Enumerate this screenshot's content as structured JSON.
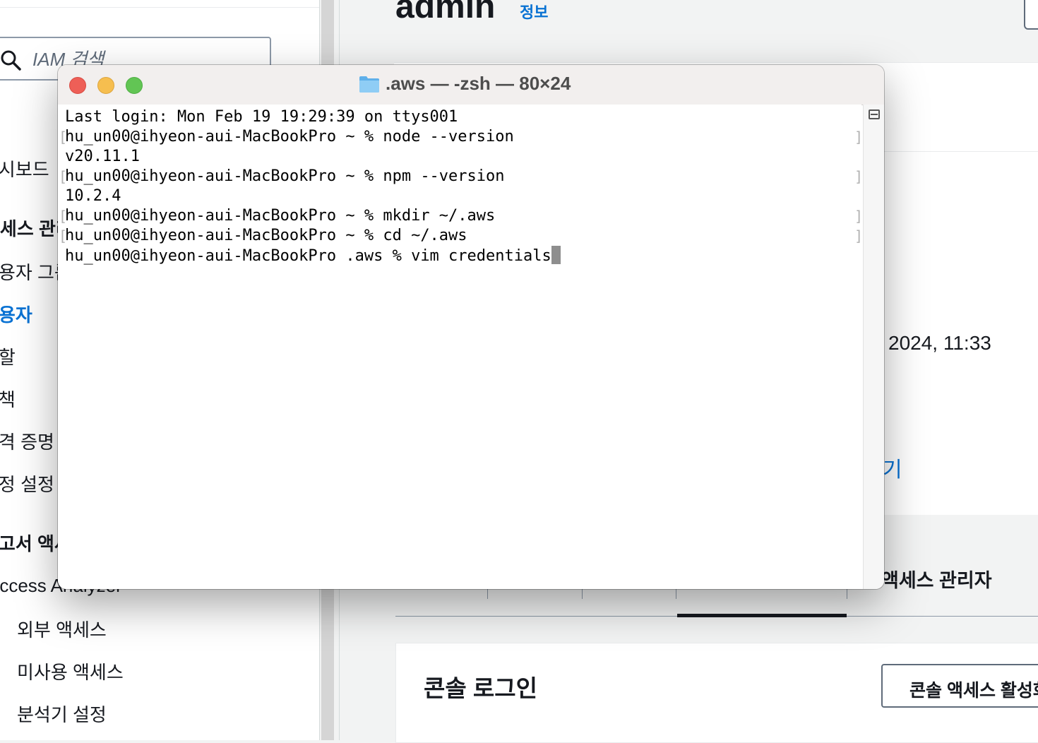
{
  "sidebar": {
    "search_placeholder": "IAM 검색",
    "items": [
      {
        "label": "대시보드"
      },
      {
        "label": "액세스 관리"
      },
      {
        "label": "사용자 그룹"
      },
      {
        "label": "사용자"
      },
      {
        "label": "역할"
      },
      {
        "label": "정책"
      },
      {
        "label": "자격 증명 공급자"
      },
      {
        "label": "계정 설정"
      },
      {
        "label": "보고서 액세스"
      },
      {
        "label": "Access Analyzer"
      },
      {
        "label": "외부 액세스"
      },
      {
        "label": "미사용 액세스"
      },
      {
        "label": "분석기 설정"
      }
    ]
  },
  "main": {
    "page_title": "admin",
    "info_link": "정보",
    "created_value": "2024, 11:33",
    "link_fragment": "기",
    "active_tab_label": "액세스 관리자",
    "console_section_title": "콘솔 로그인",
    "console_button_label": "콘솔 액세스 활성화"
  },
  "terminal": {
    "title": ".aws — -zsh — 80×24",
    "lines": [
      "Last login: Mon Feb 19 19:29:39 on ttys001",
      "hu_un00@ihyeon-aui-MacBookPro ~ % node --version",
      "v20.11.1",
      "hu_un00@ihyeon-aui-MacBookPro ~ % npm --version",
      "10.2.4",
      "hu_un00@ihyeon-aui-MacBookPro ~ % mkdir ~/.aws",
      "hu_un00@ihyeon-aui-MacBookPro ~ % cd ~/.aws",
      "hu_un00@ihyeon-aui-MacBookPro .aws % vim credentials"
    ]
  },
  "colors": {
    "aws_link_blue": "#0972d3",
    "traffic_close": "#ee5f57",
    "traffic_minimize": "#f6be4f",
    "traffic_maximize": "#62c554"
  }
}
